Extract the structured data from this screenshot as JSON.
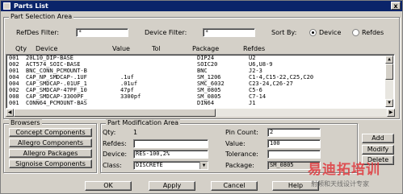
{
  "window": {
    "title": "Parts List",
    "close_glyph": "x"
  },
  "selection": {
    "legend": "Part Selection Area",
    "refdes_label": "RefDes Filter:",
    "refdes_value": "*",
    "device_label": "Device Filter:",
    "device_value": "*",
    "sortby_label": "Sort By:",
    "sort_device": "Device",
    "sort_refdes": "Refdes",
    "headers": {
      "qty": "Qty",
      "device": "Device",
      "value": "Value",
      "tol": "Tol",
      "package": "Package",
      "refdes": "Refdes"
    },
    "rows": [
      {
        "qty": "001",
        "device": "20L10_DIP-BASE",
        "value": "",
        "tol": "",
        "package": "DIP24",
        "refdes": "U2"
      },
      {
        "qty": "002",
        "device": "ACT574_SOIC-BASE",
        "value": "",
        "tol": "",
        "package": "SOIC20",
        "refdes": "U6,U8-9"
      },
      {
        "qty": "001",
        "device": "BNC_CONN_PCMOUNT-B",
        "value": "",
        "tol": "",
        "package": "BNC",
        "refdes": "J2-3"
      },
      {
        "qty": "004",
        "device": "CAP_NP_SMDCAP-.1UF",
        "value": ".1uf",
        "tol": "",
        "package": "SM_1206",
        "refdes": "C1-4,C15-22,C25,C20"
      },
      {
        "qty": "004",
        "device": "CAP_SMDCAP-.01UF_1",
        "value": ".01uf",
        "tol": "",
        "package": "SMC_6032",
        "refdes": "C23-24,C26-27"
      },
      {
        "qty": "002",
        "device": "CAP_SMDCAP-47PF_10",
        "value": "47pf",
        "tol": "",
        "package": "SM_0805",
        "refdes": "C5-6"
      },
      {
        "qty": "008",
        "device": "CAP_SMDCAP-3300PF_",
        "value": "3300pf",
        "tol": "",
        "package": "SM_0805",
        "refdes": "C7-14"
      },
      {
        "qty": "001",
        "device": "CONN64_PCMOUNT-BAS",
        "value": "",
        "tol": "",
        "package": "DIN64",
        "refdes": "J1"
      }
    ]
  },
  "browsers": {
    "legend": "Browsers",
    "buttons": [
      "Concept Components",
      "Allegro Components",
      "Allegro Packages",
      "Signoise Components"
    ]
  },
  "modification": {
    "legend": "Part Modification Area",
    "qty_label": "Qty:",
    "qty_value": "1",
    "refdes_label": "Refdes:",
    "refdes_value": "",
    "device_label": "Device:",
    "device_value": "RES-100,2%",
    "class_label": "Class:",
    "class_value": "DISCRETE",
    "pincount_label": "Pin Count:",
    "pincount_value": "2",
    "value_label": "Value:",
    "value_value": "100",
    "tolerance_label": "Tolerance:",
    "tolerance_value": "",
    "package_label": "Package:",
    "package_value": "SM_0805"
  },
  "side_buttons": {
    "add": "Add",
    "modify": "Modify",
    "delete": "Delete"
  },
  "footer": {
    "ok": "OK",
    "apply": "Apply",
    "cancel": "Cancel",
    "help": "Help"
  },
  "watermark": {
    "line1": "易迪拓培训",
    "line2": "射频和天线设计专家"
  }
}
